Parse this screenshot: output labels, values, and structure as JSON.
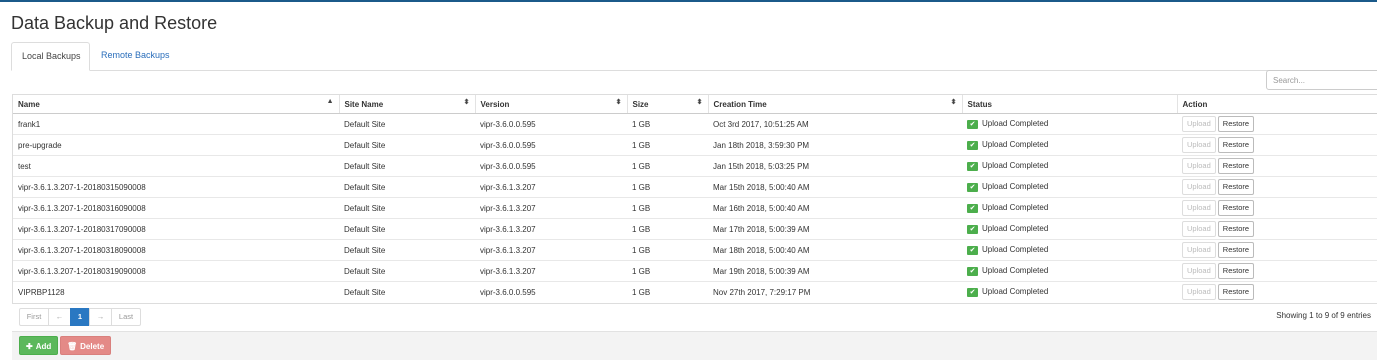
{
  "page": {
    "title": "Data Backup and Restore"
  },
  "tabs": [
    {
      "label": "Local Backups",
      "active": true
    },
    {
      "label": "Remote Backups",
      "active": false
    }
  ],
  "search": {
    "placeholder": "Search..."
  },
  "table": {
    "columns": [
      {
        "label": "Name",
        "sort": "▲"
      },
      {
        "label": "Site Name",
        "sort": "⬍"
      },
      {
        "label": "Version",
        "sort": "⬍"
      },
      {
        "label": "Size",
        "sort": "⬍"
      },
      {
        "label": "Creation Time",
        "sort": "⬍"
      },
      {
        "label": "Status",
        "sort": ""
      },
      {
        "label": "Action",
        "sort": ""
      }
    ],
    "rows": [
      {
        "name": "frank1",
        "site": "Default Site",
        "version": "vipr-3.6.0.0.595",
        "size": "1 GB",
        "created": "Oct 3rd 2017, 10:51:25 AM",
        "status": "Upload Completed"
      },
      {
        "name": "pre-upgrade",
        "site": "Default Site",
        "version": "vipr-3.6.0.0.595",
        "size": "1 GB",
        "created": "Jan 18th 2018, 3:59:30 PM",
        "status": "Upload Completed"
      },
      {
        "name": "test",
        "site": "Default Site",
        "version": "vipr-3.6.0.0.595",
        "size": "1 GB",
        "created": "Jan 15th 2018, 5:03:25 PM",
        "status": "Upload Completed"
      },
      {
        "name": "vipr-3.6.1.3.207-1-20180315090008",
        "site": "Default Site",
        "version": "vipr-3.6.1.3.207",
        "size": "1 GB",
        "created": "Mar 15th 2018, 5:00:40 AM",
        "status": "Upload Completed"
      },
      {
        "name": "vipr-3.6.1.3.207-1-20180316090008",
        "site": "Default Site",
        "version": "vipr-3.6.1.3.207",
        "size": "1 GB",
        "created": "Mar 16th 2018, 5:00:40 AM",
        "status": "Upload Completed"
      },
      {
        "name": "vipr-3.6.1.3.207-1-20180317090008",
        "site": "Default Site",
        "version": "vipr-3.6.1.3.207",
        "size": "1 GB",
        "created": "Mar 17th 2018, 5:00:39 AM",
        "status": "Upload Completed"
      },
      {
        "name": "vipr-3.6.1.3.207-1-20180318090008",
        "site": "Default Site",
        "version": "vipr-3.6.1.3.207",
        "size": "1 GB",
        "created": "Mar 18th 2018, 5:00:40 AM",
        "status": "Upload Completed"
      },
      {
        "name": "vipr-3.6.1.3.207-1-20180319090008",
        "site": "Default Site",
        "version": "vipr-3.6.1.3.207",
        "size": "1 GB",
        "created": "Mar 19th 2018, 5:00:39 AM",
        "status": "Upload Completed"
      },
      {
        "name": "VIPRBP1128",
        "site": "Default Site",
        "version": "vipr-3.6.0.0.595",
        "size": "1 GB",
        "created": "Nov 27th 2017, 7:29:17 PM",
        "status": "Upload Completed"
      }
    ],
    "actions": {
      "upload": "Upload",
      "restore": "Restore",
      "upload_disabled": true
    }
  },
  "pagination": {
    "first": "First",
    "prev": "←",
    "current": "1",
    "next": "→",
    "last": "Last",
    "info": "Showing 1 to 9 of 9 entries"
  },
  "footer": {
    "add_label": "Add",
    "delete_label": "Delete",
    "add_icon": "plus-icon",
    "delete_icon": "trash-icon"
  },
  "colors": {
    "accent": "#2a78c2",
    "success": "#5cb85c",
    "danger": "#e48a87",
    "link": "#2a6ebb"
  }
}
